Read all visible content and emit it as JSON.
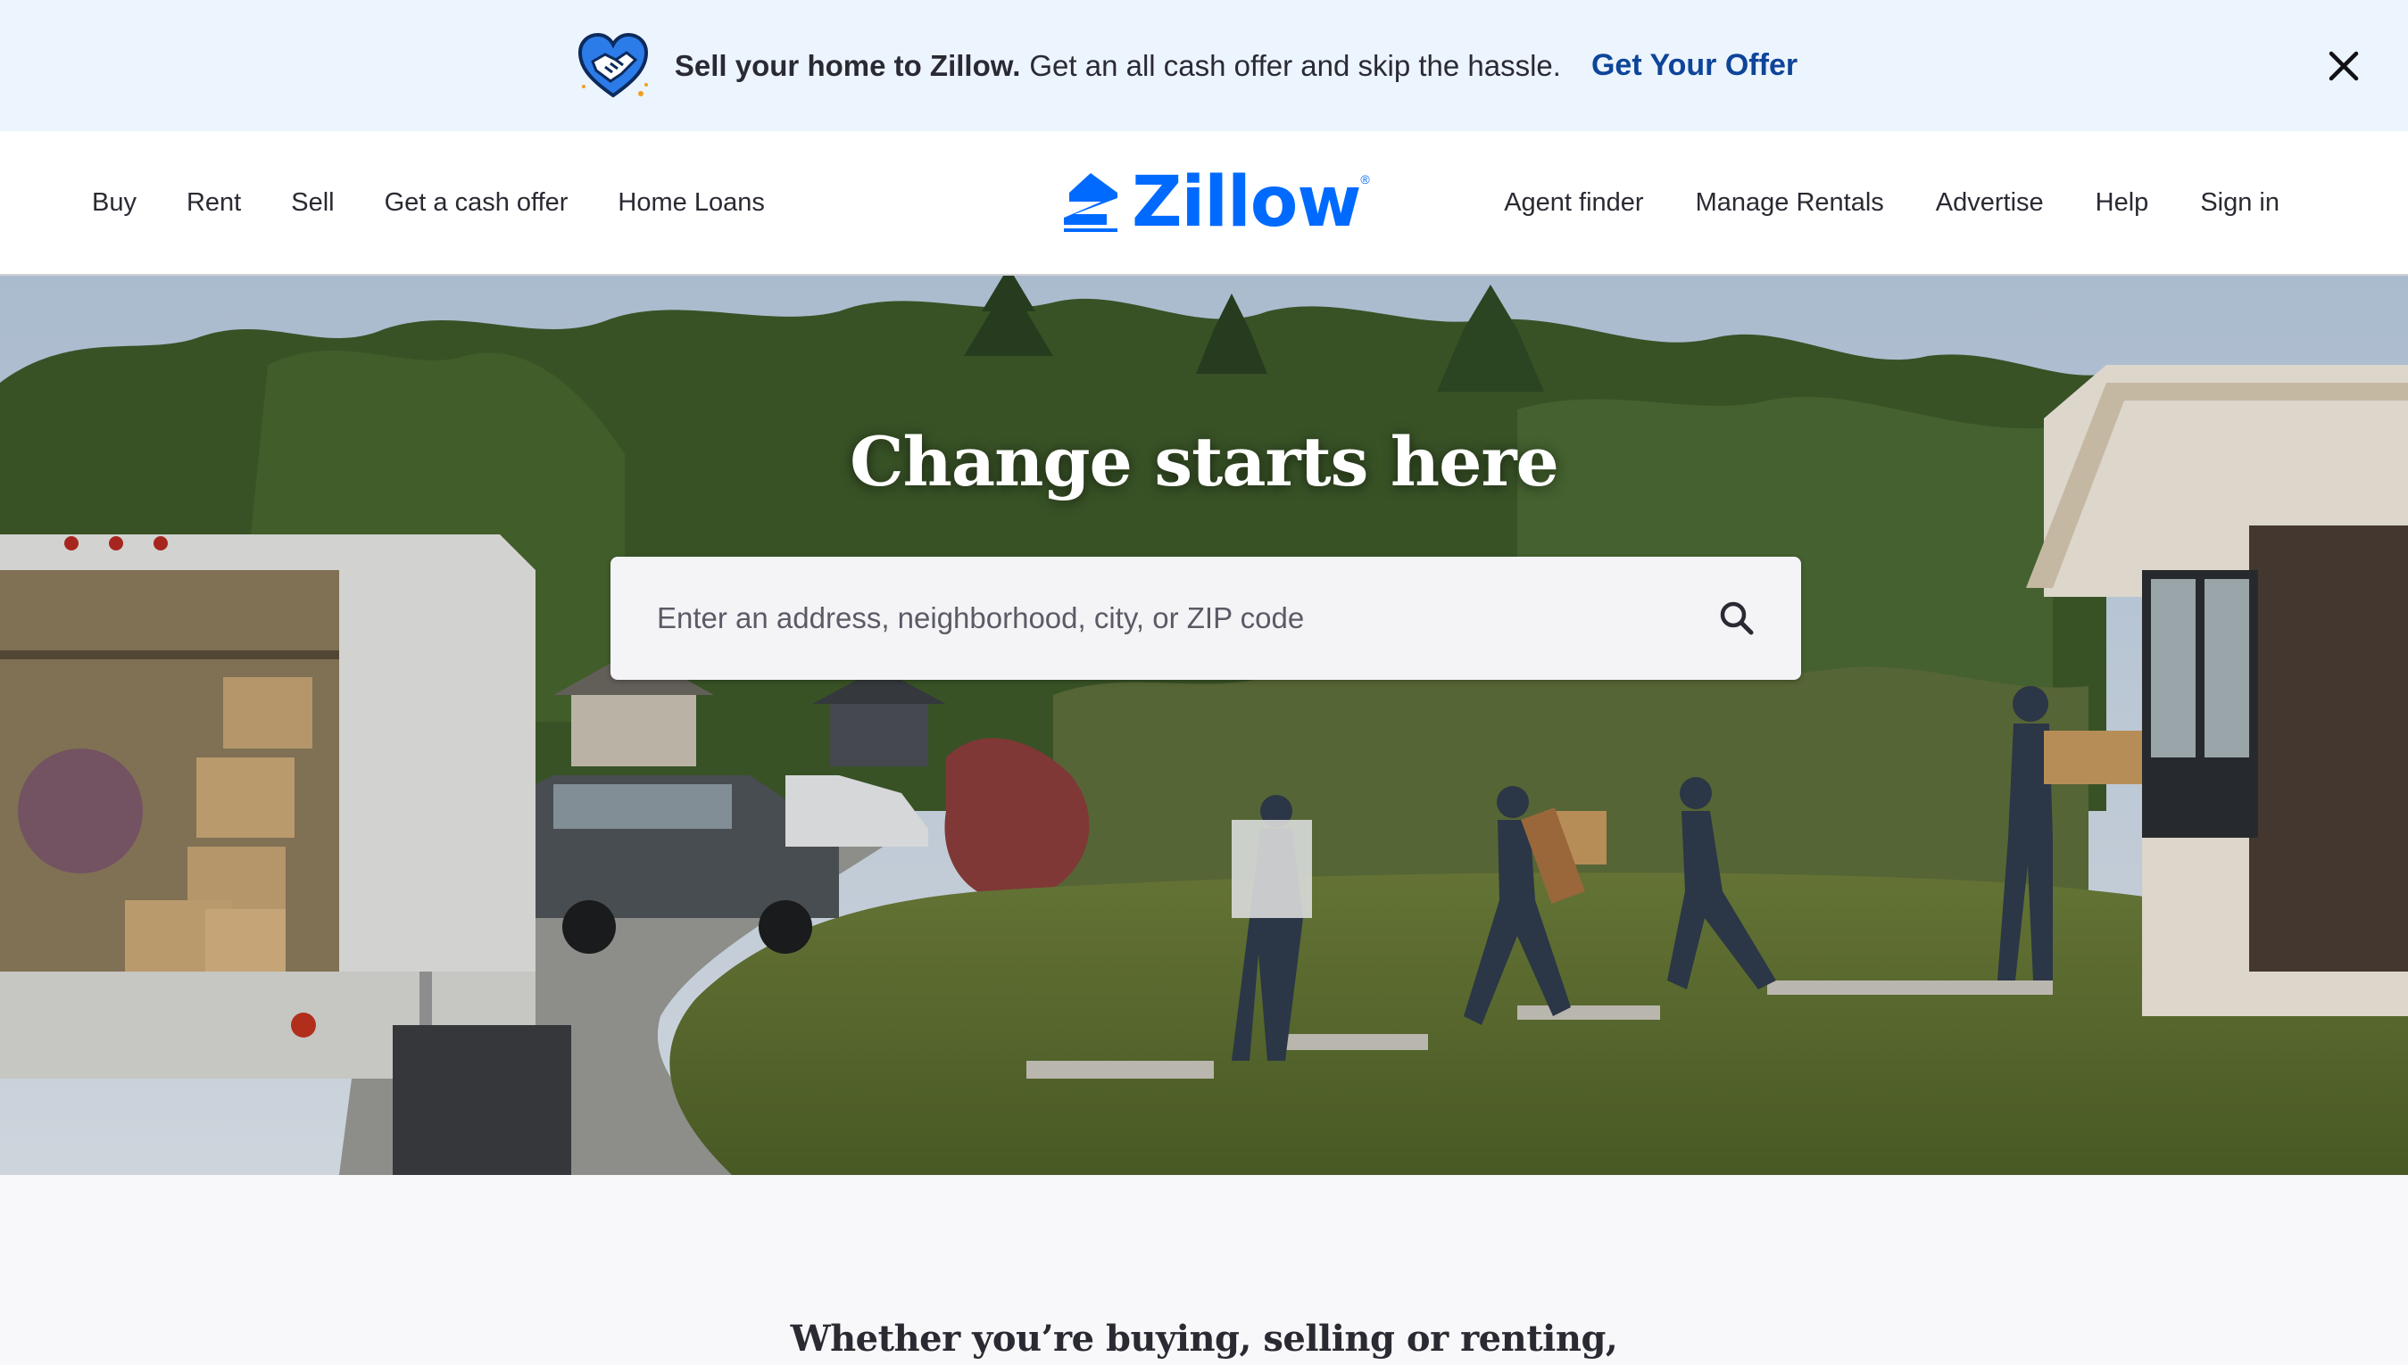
{
  "promo": {
    "icon": "handshake-heart-icon",
    "strong_text": "Sell your home to Zillow.",
    "text": "Get an all cash offer and skip the hassle.",
    "link_label": "Get Your Offer",
    "close_icon": "close-icon",
    "background": "#ecf4fd",
    "link_color": "#0d4599"
  },
  "header": {
    "left_nav": [
      "Buy",
      "Rent",
      "Sell",
      "Get a cash offer",
      "Home Loans"
    ],
    "logo_text": "Zillow",
    "logo_reg": "®",
    "logo_color": "#006aff",
    "right_nav": [
      "Agent finder",
      "Manage Rentals",
      "Advertise",
      "Help",
      "Sign in"
    ]
  },
  "hero": {
    "title": "Change starts here",
    "search_placeholder": "Enter an address, neighborhood, city, or ZIP code",
    "search_value": "",
    "search_icon": "search-icon",
    "image_description_icon": "family-moving-photo"
  },
  "section": {
    "heading": "Whether you’re buying, selling or renting,"
  }
}
